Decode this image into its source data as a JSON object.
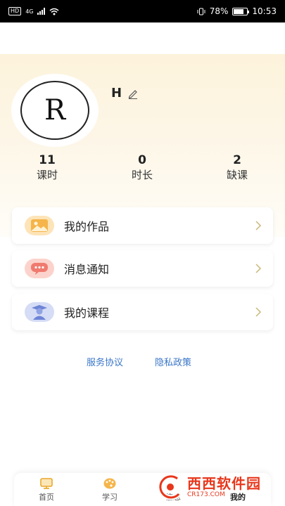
{
  "status": {
    "hd": "HD",
    "network": "4G",
    "battery": "78%",
    "battery_level": 0.78,
    "time": "10:53"
  },
  "profile": {
    "avatar_letter": "R",
    "name": "H"
  },
  "stats": [
    {
      "value": "11",
      "label": "课时"
    },
    {
      "value": "0",
      "label": "时长"
    },
    {
      "value": "2",
      "label": "缺课"
    }
  ],
  "menu": [
    {
      "label": "我的作品",
      "icon": "image-icon",
      "color": "#f5b54a"
    },
    {
      "label": "消息通知",
      "icon": "message-icon",
      "color": "#f07a6e"
    },
    {
      "label": "我的课程",
      "icon": "student-icon",
      "color": "#6d84d6"
    }
  ],
  "links": {
    "service": "服务协议",
    "privacy": "隐私政策"
  },
  "tabs": [
    {
      "label": "首页",
      "icon": "home-icon"
    },
    {
      "label": "学习",
      "icon": "palette-icon"
    },
    {
      "label": "信息",
      "icon": "info-icon"
    },
    {
      "label": "我的",
      "icon": "profile-icon"
    }
  ],
  "watermark": {
    "main": "西西软件园",
    "sub": "CR173.COM"
  },
  "colors": {
    "accent": "#f5b54a",
    "link": "#3a76c8",
    "watermark": "#e8371c"
  }
}
